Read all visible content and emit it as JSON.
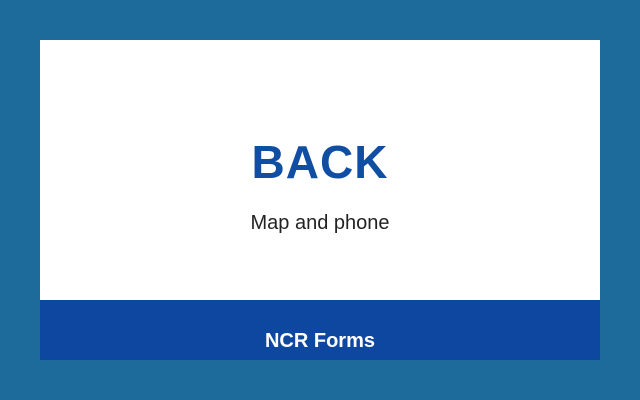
{
  "card": {
    "title": "BACK",
    "subtitle": "Map and phone"
  },
  "footer": {
    "label": "NCR Forms"
  },
  "colors": {
    "page_background": "#1d6b9b",
    "card_background": "#ffffff",
    "title": "#0f4ea2",
    "subtitle": "#222222",
    "footer_background": "#0e47a0",
    "footer_text": "#ffffff"
  }
}
